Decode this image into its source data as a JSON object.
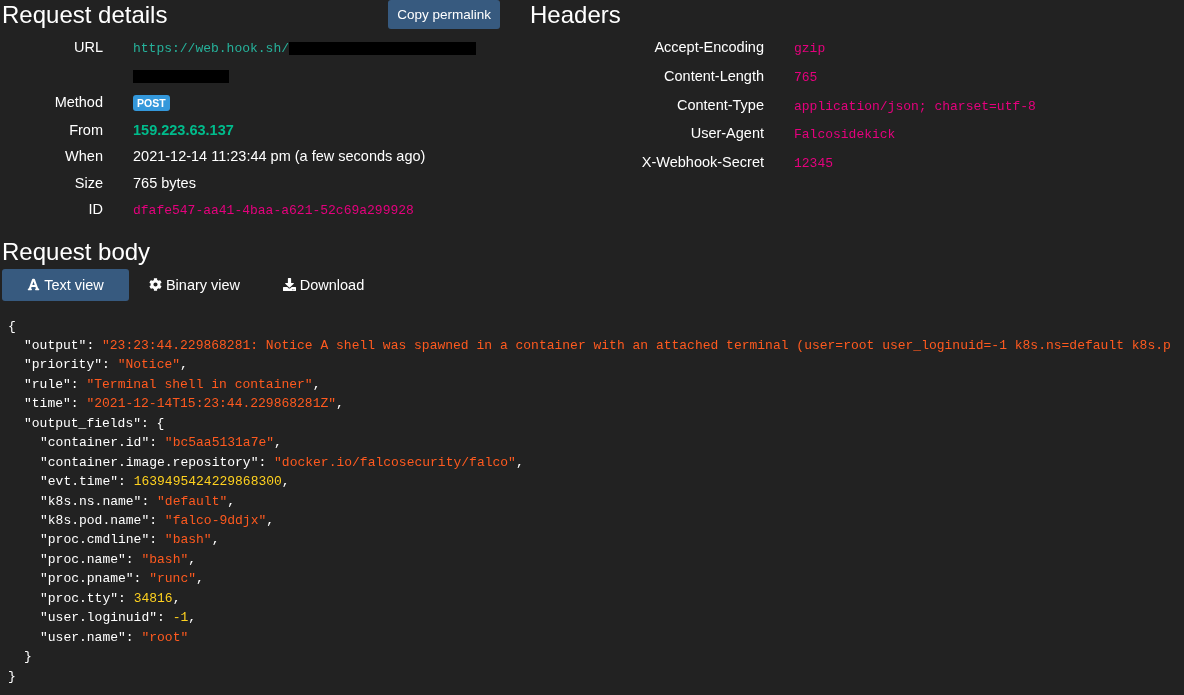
{
  "details": {
    "title": "Request details",
    "permalink_button": "Copy permalink",
    "rows": [
      {
        "label": "URL",
        "value": "https://web.hook.sh/",
        "kind": "url",
        "redacted": true
      },
      {
        "label": "Method",
        "value": "POST",
        "kind": "badge"
      },
      {
        "label": "From",
        "value": "159.223.63.137",
        "kind": "ip"
      },
      {
        "label": "When",
        "value": "2021-12-14 11:23:44 pm (a few seconds ago)",
        "kind": "text"
      },
      {
        "label": "Size",
        "value": "765 bytes",
        "kind": "text"
      },
      {
        "label": "ID",
        "value": "dfafe547-aa41-4baa-a621-52c69a299928",
        "kind": "code"
      }
    ]
  },
  "headers": {
    "title": "Headers",
    "rows": [
      {
        "name": "Accept-Encoding",
        "value": "gzip"
      },
      {
        "name": "Content-Length",
        "value": "765"
      },
      {
        "name": "Content-Type",
        "value": "application/json; charset=utf-8"
      },
      {
        "name": "User-Agent",
        "value": "Falcosidekick"
      },
      {
        "name": "X-Webhook-Secret",
        "value": "12345"
      }
    ]
  },
  "body": {
    "title": "Request body",
    "views": [
      {
        "label": "Text view",
        "selected": true
      },
      {
        "label": "Binary view",
        "selected": false
      },
      {
        "label": "Download",
        "selected": false
      }
    ],
    "lines": [
      {
        "tokens": [
          {
            "kind": "plain",
            "text": "{"
          }
        ],
        "children": [
          {
            "tokens": [
              {
                "kind": "plain",
                "text": "\"output\": "
              },
              {
                "kind": "string",
                "text": "\"23:23:44.229868281: Notice A shell was spawned in a container with an attached terminal (user=root user_loginuid=-1 k8s.ns=default k8s.p"
              }
            ]
          },
          {
            "tokens": [
              {
                "kind": "plain",
                "text": "\"priority\": "
              },
              {
                "kind": "string",
                "text": "\"Notice\""
              },
              {
                "kind": "plain",
                "text": ","
              }
            ]
          },
          {
            "tokens": [
              {
                "kind": "plain",
                "text": "\"rule\": "
              },
              {
                "kind": "string",
                "text": "\"Terminal shell in container\""
              },
              {
                "kind": "plain",
                "text": ","
              }
            ]
          },
          {
            "tokens": [
              {
                "kind": "plain",
                "text": "\"time\": "
              },
              {
                "kind": "string",
                "text": "\"2021-12-14T15:23:44.229868281Z\""
              },
              {
                "kind": "plain",
                "text": ","
              }
            ]
          },
          {
            "tokens": [
              {
                "kind": "plain",
                "text": "\"output_fields\": {"
              }
            ],
            "children": [
              {
                "tokens": [
                  {
                    "kind": "plain",
                    "text": "\"container.id\": "
                  },
                  {
                    "kind": "string",
                    "text": "\"bc5aa5131a7e\""
                  },
                  {
                    "kind": "plain",
                    "text": ","
                  }
                ]
              },
              {
                "tokens": [
                  {
                    "kind": "plain",
                    "text": "\"container.image.repository\": "
                  },
                  {
                    "kind": "string",
                    "text": "\"docker.io/falcosecurity/falco\""
                  },
                  {
                    "kind": "plain",
                    "text": ","
                  }
                ]
              },
              {
                "tokens": [
                  {
                    "kind": "plain",
                    "text": "\"evt.time\": "
                  },
                  {
                    "kind": "number",
                    "text": "1639495424229868300"
                  },
                  {
                    "kind": "plain",
                    "text": ","
                  }
                ]
              },
              {
                "tokens": [
                  {
                    "kind": "plain",
                    "text": "\"k8s.ns.name\": "
                  },
                  {
                    "kind": "string",
                    "text": "\"default\""
                  },
                  {
                    "kind": "plain",
                    "text": ","
                  }
                ]
              },
              {
                "tokens": [
                  {
                    "kind": "plain",
                    "text": "\"k8s.pod.name\": "
                  },
                  {
                    "kind": "string",
                    "text": "\"falco-9ddjx\""
                  },
                  {
                    "kind": "plain",
                    "text": ","
                  }
                ]
              },
              {
                "tokens": [
                  {
                    "kind": "plain",
                    "text": "\"proc.cmdline\": "
                  },
                  {
                    "kind": "string",
                    "text": "\"bash\""
                  },
                  {
                    "kind": "plain",
                    "text": ","
                  }
                ]
              },
              {
                "tokens": [
                  {
                    "kind": "plain",
                    "text": "\"proc.name\": "
                  },
                  {
                    "kind": "string",
                    "text": "\"bash\""
                  },
                  {
                    "kind": "plain",
                    "text": ","
                  }
                ]
              },
              {
                "tokens": [
                  {
                    "kind": "plain",
                    "text": "\"proc.pname\": "
                  },
                  {
                    "kind": "string",
                    "text": "\"runc\""
                  },
                  {
                    "kind": "plain",
                    "text": ","
                  }
                ]
              },
              {
                "tokens": [
                  {
                    "kind": "plain",
                    "text": "\"proc.tty\": "
                  },
                  {
                    "kind": "number",
                    "text": "34816"
                  },
                  {
                    "kind": "plain",
                    "text": ","
                  }
                ]
              },
              {
                "tokens": [
                  {
                    "kind": "plain",
                    "text": "\"user.loginuid\": "
                  },
                  {
                    "kind": "number",
                    "text": "-1"
                  },
                  {
                    "kind": "plain",
                    "text": ","
                  }
                ]
              },
              {
                "tokens": [
                  {
                    "kind": "plain",
                    "text": "\"user.name\": "
                  },
                  {
                    "kind": "string",
                    "text": "\"root\""
                  }
                ]
              }
            ]
          },
          {
            "tokens": [
              {
                "kind": "plain",
                "text": "}"
              }
            ]
          }
        ]
      },
      {
        "tokens": [
          {
            "kind": "plain",
            "text": "}"
          }
        ]
      }
    ]
  }
}
